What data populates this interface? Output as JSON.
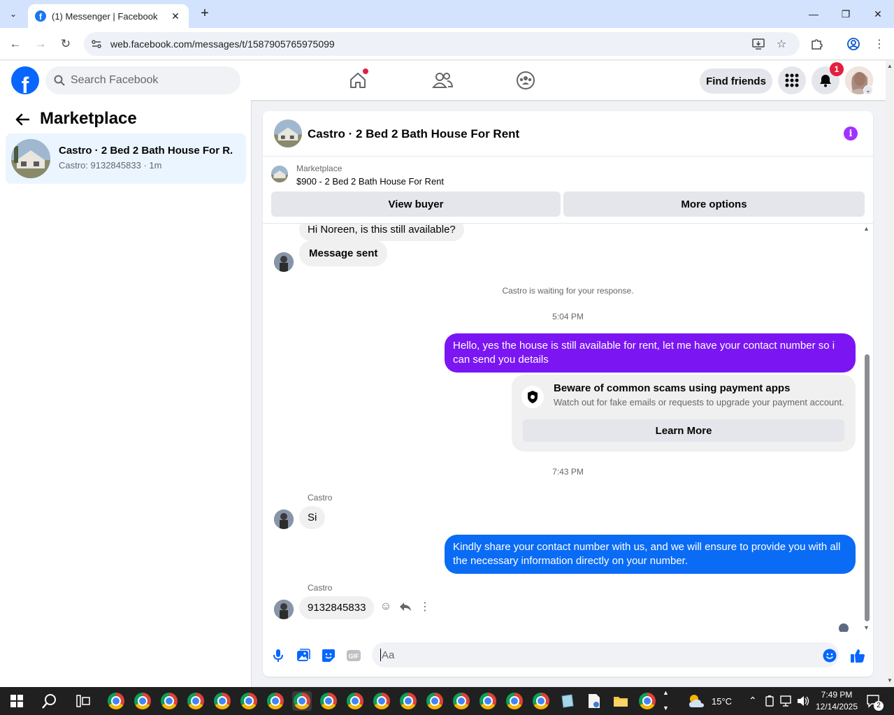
{
  "browser": {
    "tab_title": "(1) Messenger | Facebook",
    "url": "web.facebook.com/messages/t/1587905765975099"
  },
  "header": {
    "search_placeholder": "Search Facebook",
    "find_friends": "Find friends",
    "notification_count": "1"
  },
  "left_panel": {
    "title": "Marketplace",
    "conversation": {
      "title": "Castro · 2 Bed 2 Bath House For R...",
      "subtitle": "Castro: 9132845833 · 1m"
    }
  },
  "chat": {
    "title": "Castro · 2 Bed 2 Bath House For Rent",
    "marketplace_label": "Marketplace",
    "listing": "$900 - 2 Bed 2 Bath House For Rent",
    "view_buyer": "View buyer",
    "more_options": "More options",
    "messages": {
      "m1": "Hi Noreen, is this still available?",
      "m2": "Message sent",
      "waiting": "Castro is waiting for your response.",
      "time1": "5:04 PM",
      "out1": "Hello, yes the house is still available for rent, let me have your contact number so i can send you  details",
      "scam_title": "Beware of common scams using payment apps",
      "scam_sub": "Watch out for fake emails or requests to upgrade your payment account.",
      "learn_more": "Learn More",
      "time2": "7:43 PM",
      "sender1": "Castro",
      "in_si": "Si",
      "out2": "Kindly share your contact number with us, and we will ensure to provide you with all the necessary information directly on your number.",
      "sender2": "Castro",
      "in_number": "9132845833"
    },
    "composer_placeholder": "Aa"
  },
  "taskbar": {
    "temperature": "15°C",
    "time": "7:49 PM",
    "date": "12/14/2025",
    "notifications": "2"
  },
  "colors": {
    "fb_blue": "#0866ff",
    "purple_bubble": "#7b16f3",
    "blue_bubble": "#0a6cf5"
  }
}
